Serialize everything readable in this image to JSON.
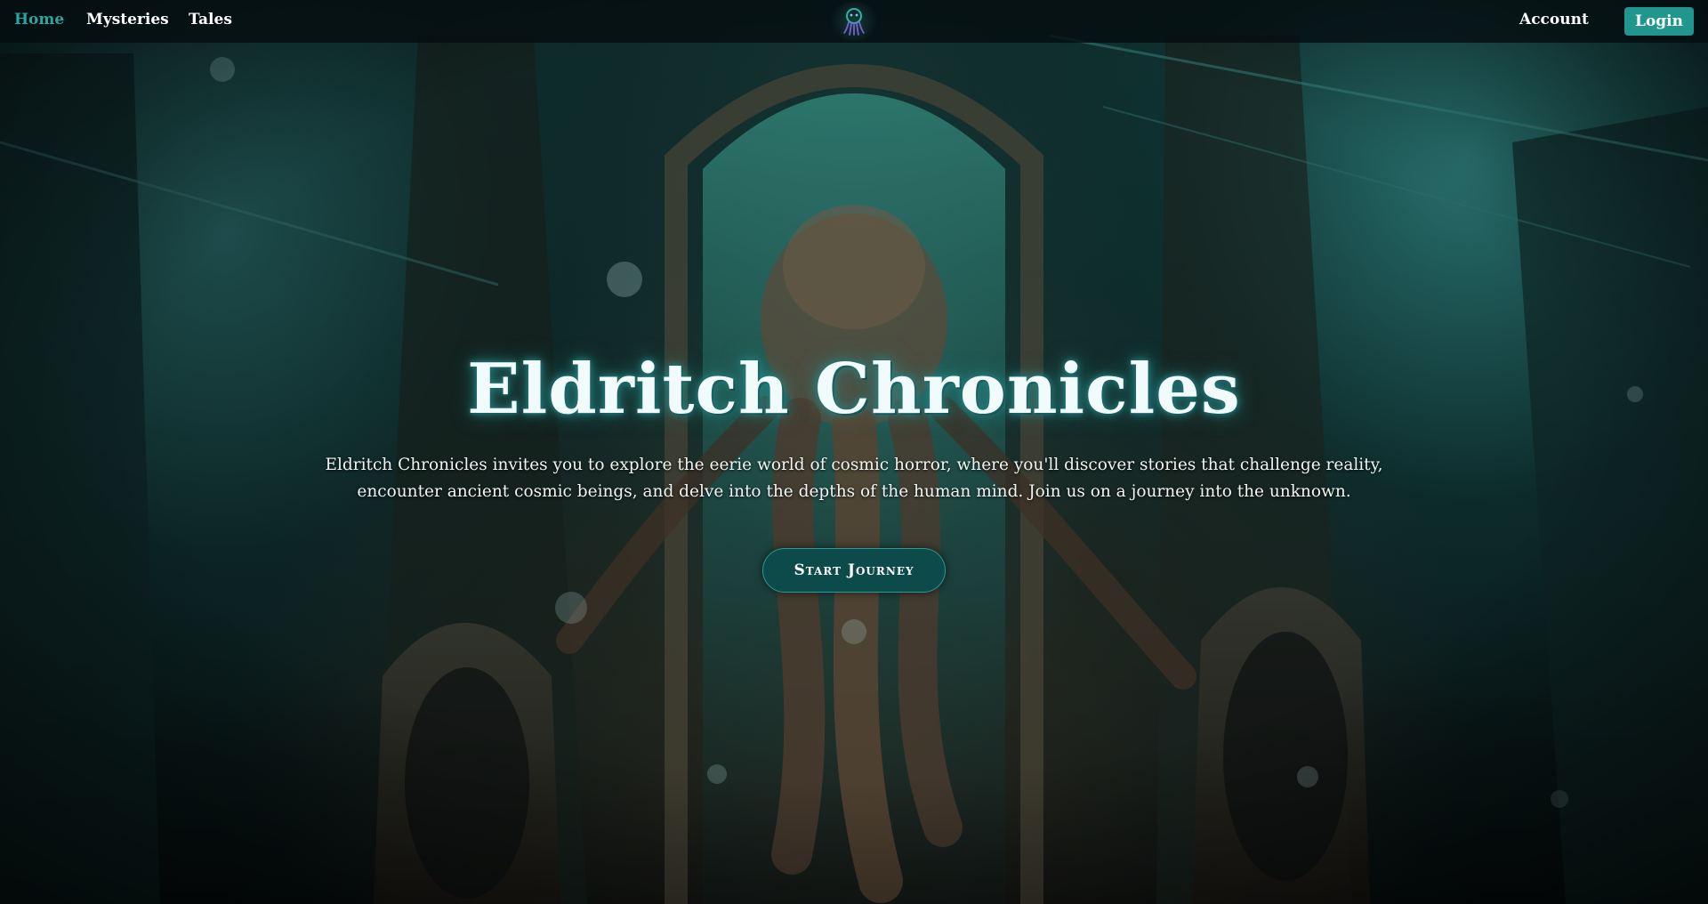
{
  "nav": {
    "home_label": "Home",
    "mysteries_label": "Mysteries",
    "tales_label": "Tales",
    "account_label": "Account",
    "login_label": "Login",
    "logo_icon": "cthulhu-emblem-icon",
    "active_color": "#2aa6a0",
    "login_color": "#20968f"
  },
  "hero": {
    "title": "Eldritch Chronicles",
    "description": "Eldritch Chronicles invites you to explore the eerie world of cosmic horror, where you'll discover stories that challenge reality, encounter ancient cosmic beings, and delve into the depths of the human mind. Join us on a journey into the unknown.",
    "cta_label": "Start Journey",
    "accent_color": "#2aa6a0"
  }
}
